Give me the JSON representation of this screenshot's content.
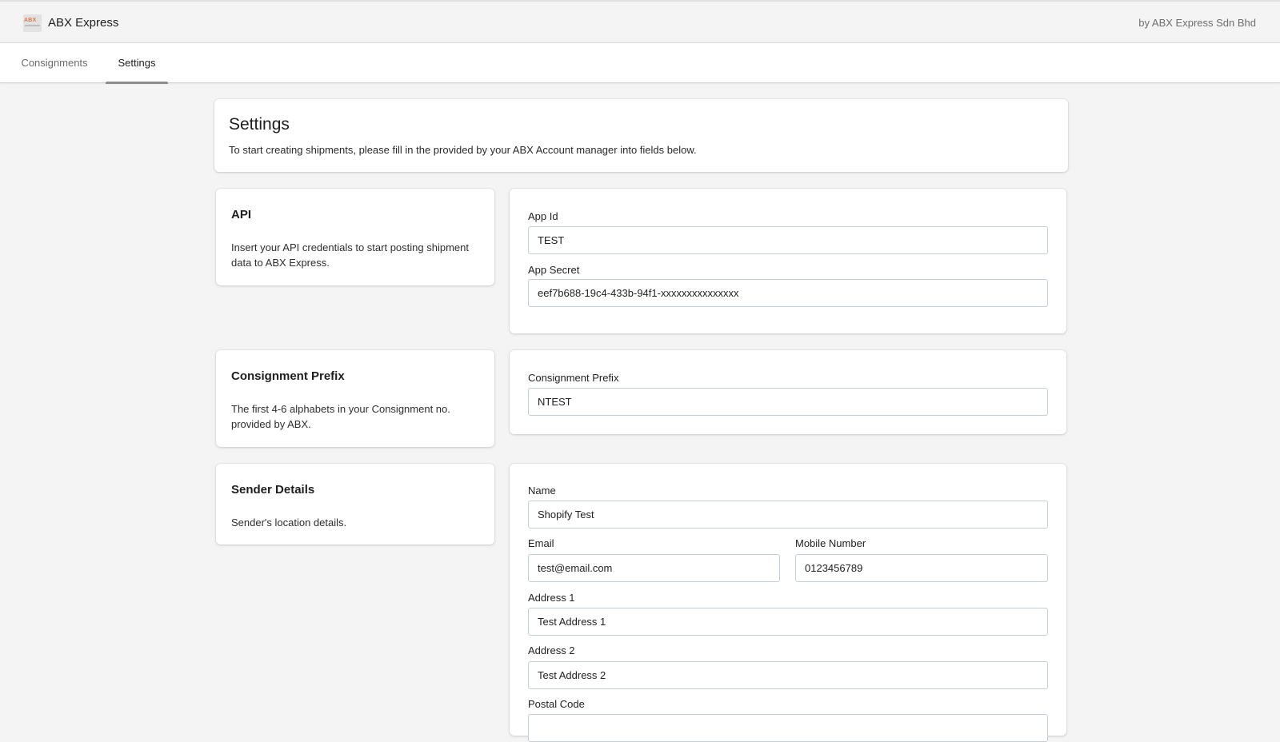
{
  "header": {
    "title": "ABX Express",
    "logo_text": "ABX",
    "byline": "by ABX Express Sdn Bhd"
  },
  "tabs": [
    {
      "label": "Consignments",
      "active": false
    },
    {
      "label": "Settings",
      "active": true
    }
  ],
  "intro": {
    "title": "Settings",
    "description": "To start creating shipments, please fill in the provided by your ABX Account manager into fields below."
  },
  "api": {
    "heading": "API",
    "description": "Insert your API credentials to start posting shipment data to ABX Express.",
    "app_id_label": "App Id",
    "app_id_value": "TEST",
    "app_secret_label": "App Secret",
    "app_secret_value": "eef7b688-19c4-433b-94f1-xxxxxxxxxxxxxxx"
  },
  "prefix": {
    "heading": "Consignment Prefix",
    "description": "The first 4-6 alphabets in your Consignment no. provided by ABX.",
    "label": "Consignment Prefix",
    "value": "NTEST"
  },
  "sender": {
    "heading": "Sender Details",
    "description": "Sender's location details.",
    "name_label": "Name",
    "name_value": "Shopify Test",
    "email_label": "Email",
    "email_value": "test@email.com",
    "mobile_label": "Mobile Number",
    "mobile_value": "0123456789",
    "address1_label": "Address 1",
    "address1_value": "Test Address 1",
    "address2_label": "Address 2",
    "address2_value": "Test Address 2",
    "postal_label": "Postal Code",
    "postal_value": ""
  },
  "colors": {
    "background": "#f4f4f4",
    "card": "#ffffff",
    "input_border": "#c4cdd5",
    "tab_indicator": "#8c8c8c"
  }
}
